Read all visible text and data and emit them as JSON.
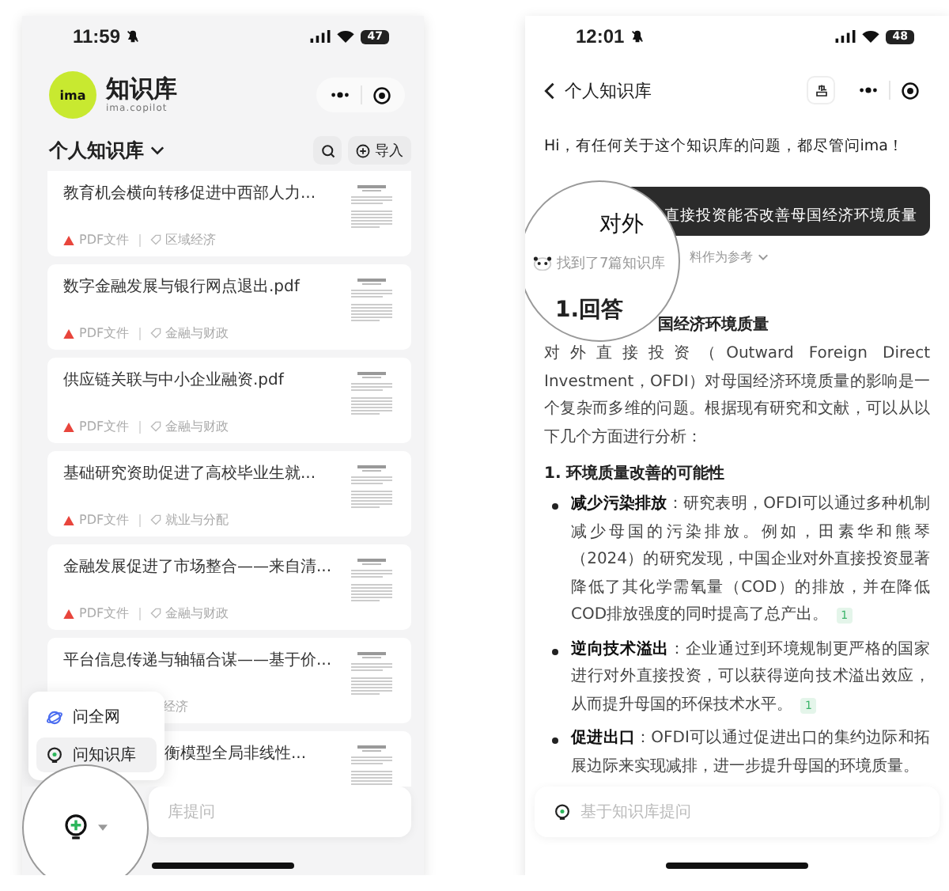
{
  "left_phone": {
    "status_bar": {
      "time": "11:59",
      "battery": "47"
    },
    "app": {
      "name": "知识库",
      "subtitle": "ima.copilot",
      "logo": "ima"
    },
    "library": {
      "title": "个人知识库",
      "import_button": "导入"
    },
    "documents": [
      {
        "title": "教育机会横向转移促进中西部人力...",
        "file_type": "PDF文件",
        "tag": "区域经济"
      },
      {
        "title": "数字金融发展与银行网点退出.pdf",
        "file_type": "PDF文件",
        "tag": "金融与财政"
      },
      {
        "title": "供应链关联与中小企业融资.pdf",
        "file_type": "PDF文件",
        "tag": "金融与财政"
      },
      {
        "title": "基础研究资助促进了高校毕业生就...",
        "file_type": "PDF文件",
        "tag": "就业与分配"
      },
      {
        "title": "金融发展促进了市场整合——来自清...",
        "file_type": "PDF文件",
        "tag": "金融与财政"
      },
      {
        "title": "平台信息传递与轴辐合谋——基于价...",
        "tag": "经济"
      },
      {
        "title": "衡模型全局非线性..."
      }
    ],
    "ask_menu": [
      {
        "kind": "web",
        "label": "问全网",
        "selected": false
      },
      {
        "kind": "knowledge",
        "label": "问知识库",
        "selected": true
      }
    ],
    "input": {
      "placeholder": "库提问"
    }
  },
  "right_phone": {
    "status_bar": {
      "time": "12:01",
      "battery": "48"
    },
    "nav": {
      "title": "个人知识库"
    },
    "greeting": "Hi，有任何关于这个知识库的问题，都尽管问ima！",
    "question": "直接投资能否改善母国经济环境质量",
    "sources_toggle": "料作为参考",
    "lens": {
      "question_start": "对外",
      "found": "找到了7篇知识库",
      "heading_start": "1.回答"
    },
    "heading": "国经济环境质量",
    "intro": "对外直接投资（Outward Foreign Direct Investment，OFDI）对母国经济环境质量的影响是一个复杂而多维的问题。根据现有研究和文献，可以从以下几个方面进行分析：",
    "section": "1. 环境质量改善的可能性",
    "bullets": [
      {
        "text": "**减少污染排放**：研究表明，OFDI可以通过多种机制减少母国的污染排放。例如，田素华和熊琴（2024）的研究发现，中国企业对外直接投资显著降低了其化学需氧量（COD）的排放，并在降低COD排放强度的同时提高了总产出。",
        "cite": "1"
      },
      {
        "text": "**逆向技术溢出**：企业通过到环境规制更严格的国家进行对外直接投资，可以获得逆向技术溢出效应，从而提升母国的环保技术水平。",
        "cite": "1"
      },
      {
        "text": "**促进出口**：OFDI可以通过促进出口的集约边际和拓展边际来实现减排，进一步提升母国的环境质量。"
      }
    ],
    "input": {
      "placeholder": "基于知识库提问"
    }
  }
}
